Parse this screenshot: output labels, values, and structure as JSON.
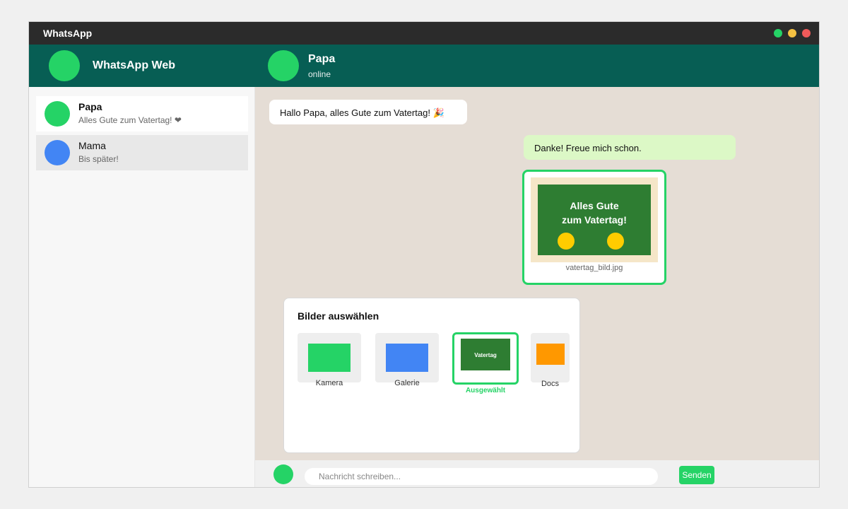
{
  "window": {
    "title": "WhatsApp"
  },
  "window_controls": [
    {
      "name": "green-dot",
      "color": "#25d366"
    },
    {
      "name": "yellow-dot",
      "color": "#f5c142"
    },
    {
      "name": "red-dot",
      "color": "#f05a5a"
    }
  ],
  "colors": {
    "header": "#075e54",
    "accent": "#25d366",
    "chat_background": "#e5ddd5",
    "outgoing_bubble": "#dcf8c6",
    "mama_avatar": "#4285f4"
  },
  "header": {
    "app_name": "WhatsApp Web",
    "contact_name": "Papa",
    "contact_status": "online"
  },
  "sidebar": {
    "chats": [
      {
        "name": "Papa",
        "preview": "Alles Gute zum Vatertag! ❤",
        "selected": true
      },
      {
        "name": "Mama",
        "preview": "Bis später!",
        "selected": false
      }
    ]
  },
  "messages": {
    "incoming": "Hallo Papa, alles Gute zum Vatertag! 🎉",
    "outgoing": "Danke! Freue mich schon.",
    "image": {
      "line1": "Alles Gute",
      "line2": "zum Vatertag!",
      "filename": "vatertag_bild.jpg"
    }
  },
  "picker": {
    "title": "Bilder auswählen",
    "options": [
      {
        "label": "Kamera",
        "icon": "green-square"
      },
      {
        "label": "Galerie",
        "icon": "blue-square"
      },
      {
        "label": "Vatertag",
        "selected_label": "Ausgewählt",
        "selected": true
      },
      {
        "label": "Docs",
        "icon": "orange-square"
      }
    ]
  },
  "composer": {
    "placeholder": "Nachricht schreiben...",
    "send_label": "Senden"
  }
}
